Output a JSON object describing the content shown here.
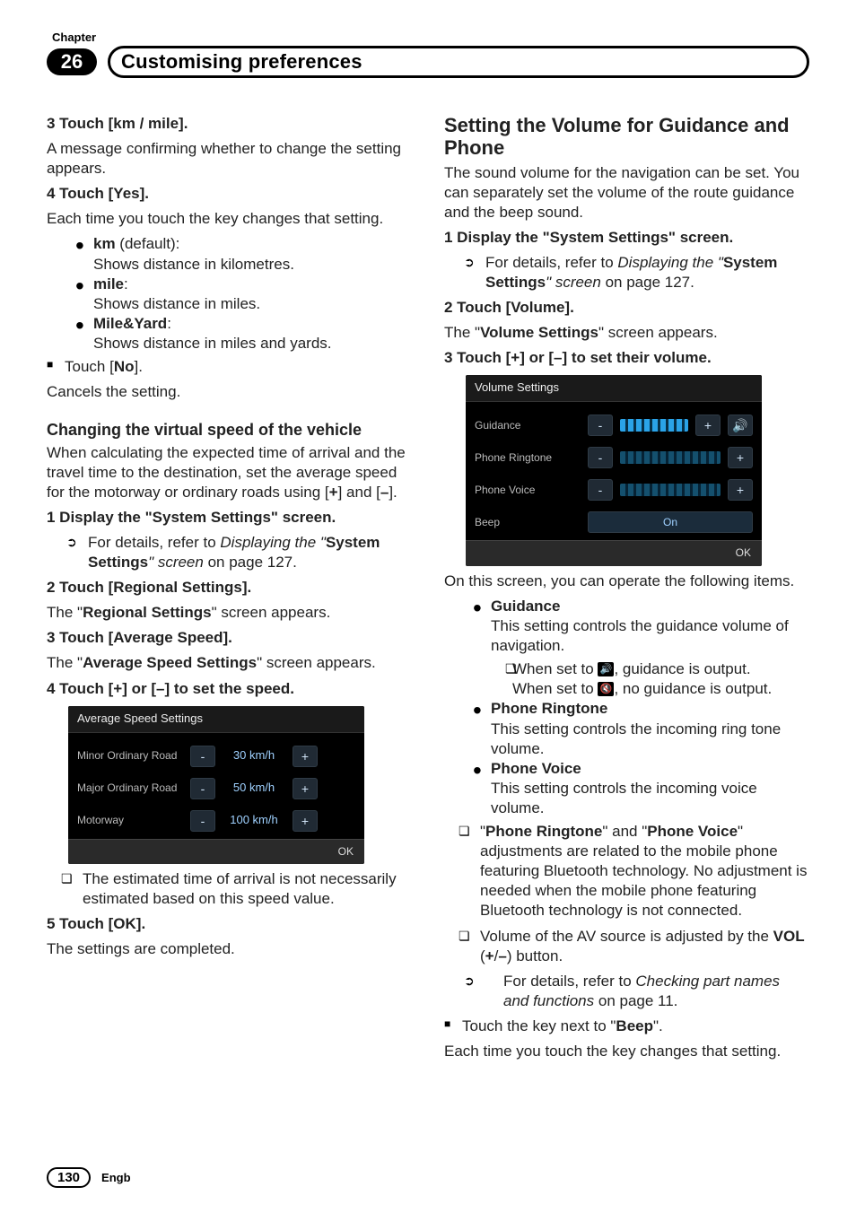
{
  "chapter_label": "Chapter",
  "chapter_number": "26",
  "chapter_title": "Customising preferences",
  "page_number": "130",
  "lang": "Engb",
  "left": {
    "step3_label": "3   Touch [km / mile].",
    "step3_body": "A message confirming whether to change the setting appears.",
    "step4_label": "4   Touch [Yes].",
    "step4_body": "Each time you touch the key changes that setting.",
    "opt_km_title": "km",
    "opt_km_suffix": " (default):",
    "opt_km_desc": "Shows distance in kilometres.",
    "opt_mile_title": "mile",
    "opt_mile_suffix": ":",
    "opt_mile_desc": "Shows distance in miles.",
    "opt_my_title": "Mile&Yard",
    "opt_my_suffix": ":",
    "opt_my_desc": "Shows distance in miles and yards.",
    "touch_no_pre": "Touch [",
    "touch_no_bold": "No",
    "touch_no_post": "].",
    "cancel": "Cancels the setting.",
    "h3_changing": "Changing the virtual speed of the vehicle",
    "changing_body": "When calculating the expected time of arrival and the travel time to the destination, set the average speed for the motorway or ordinary roads using [",
    "changing_body_plus": "+",
    "changing_body_mid": "] and [",
    "changing_body_minus": "–",
    "changing_body_end": "].",
    "cv_step1_label": "1   Display the \"System Settings\" screen.",
    "cv_step1_ref_pre": "For details, refer to ",
    "cv_step1_ref_ital1": "Displaying the \"",
    "cv_step1_ref_bold": "System Settings",
    "cv_step1_ref_ital2": "\" screen",
    "cv_step1_ref_post": " on page 127.",
    "cv_step2_label": "2   Touch [Regional Settings].",
    "cv_step2_body_pre": "The \"",
    "cv_step2_body_bold": "Regional Settings",
    "cv_step2_body_post": "\" screen appears.",
    "cv_step3_label": "3   Touch [Average Speed].",
    "cv_step3_body_pre": "The \"",
    "cv_step3_body_bold": "Average Speed Settings",
    "cv_step3_body_post": "\" screen appears.",
    "cv_step4_label": "4   Touch [+] or [–] to set the speed.",
    "cv_note": "The estimated time of arrival is not necessarily estimated based on this speed value.",
    "cv_step5_label": "5   Touch [OK].",
    "cv_step5_body": "The settings are completed.",
    "avg_shot": {
      "title": "Average Speed Settings",
      "rows": [
        {
          "label": "Minor Ordinary Road",
          "value": "30 km/h"
        },
        {
          "label": "Major Ordinary Road",
          "value": "50 km/h"
        },
        {
          "label": "Motorway",
          "value": "100 km/h"
        }
      ],
      "ok": "OK"
    }
  },
  "right": {
    "h2": "Setting the Volume for Guidance and Phone",
    "intro": "The sound volume for the navigation can be set. You can separately set the volume of the route guidance and the beep sound.",
    "step1_label": "1   Display the \"System Settings\" screen.",
    "step1_ref_pre": "For details, refer to ",
    "step1_ref_ital1": "Displaying the \"",
    "step1_ref_bold": "System Settings",
    "step1_ref_ital2": "\" screen",
    "step1_ref_post": " on page 127.",
    "step2_label": "2   Touch [Volume].",
    "step2_body_pre": "The \"",
    "step2_body_bold": "Volume Settings",
    "step2_body_post": "\" screen appears.",
    "step3_label": "3   Touch [+] or [–] to set their volume.",
    "vol_shot": {
      "title": "Volume Settings",
      "guidance": "Guidance",
      "phone_ringtone": "Phone Ringtone",
      "phone_voice": "Phone Voice",
      "beep": "Beep",
      "beep_value": "On",
      "ok": "OK"
    },
    "after_shot": "On this screen, you can operate the following items.",
    "it_guidance_title": "Guidance",
    "it_guidance_body": "This setting controls the guidance volume of navigation.",
    "it_guidance_note1_pre": "When set to ",
    "it_guidance_note1_post": ", guidance is output.",
    "it_guidance_note2_pre": "When set to ",
    "it_guidance_note2_post": ", no guidance is output.",
    "it_ring_title": "Phone Ringtone",
    "it_ring_body": "This setting controls the incoming ring tone volume.",
    "it_voice_title": "Phone Voice",
    "it_voice_body": "This setting controls the incoming voice volume.",
    "note_bt_pre": "\"",
    "note_bt_b1": "Phone Ringtone",
    "note_bt_mid": "\" and \"",
    "note_bt_b2": "Phone Voice",
    "note_bt_post": "\" adjustments are related to the mobile phone featuring Bluetooth technology. No adjustment is needed when the mobile phone featuring Bluetooth technology is not connected.",
    "note_av_pre": "Volume of the AV source is adjusted by the ",
    "note_av_bold": "VOL",
    "note_av_paren": " (",
    "note_av_plus": "+",
    "note_av_slash": "/",
    "note_av_minus": "–",
    "note_av_post": ") button.",
    "note_av_ref_pre": "For details, refer to ",
    "note_av_ref_ital": "Checking part names and functions",
    "note_av_ref_post": " on page 11.",
    "beep_touch_pre": "Touch the key next to \"",
    "beep_touch_bold": "Beep",
    "beep_touch_post": "\".",
    "beep_body": "Each time you touch the key changes that setting."
  }
}
